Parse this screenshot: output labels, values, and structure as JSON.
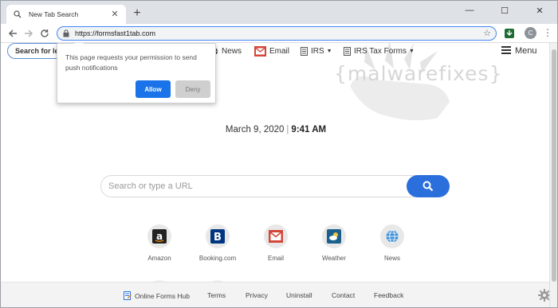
{
  "browser": {
    "tab_title": "New Tab Search",
    "tab_close": "✕",
    "new_tab": "+",
    "window_controls": {
      "minimize": "—",
      "maximize": "☐",
      "close": "✕"
    },
    "url": "https://formsfast1tab.com",
    "profile_initial": "C",
    "accent_color": "#4285f4"
  },
  "page": {
    "site_search_placeholder": "Search for legal forms",
    "topnav": [
      {
        "label": "News",
        "icon": "globe-icon"
      },
      {
        "label": "Email",
        "icon": "gmail-icon"
      },
      {
        "label": "IRS",
        "icon": "document-icon",
        "dropdown": true
      },
      {
        "label": "IRS Tax Forms",
        "icon": "document-icon",
        "dropdown": true
      }
    ],
    "menu_label": "Menu",
    "watermark": "{malwarefixes}",
    "date": "March 9, 2020",
    "time": "9:41 AM",
    "separator": "|",
    "search_placeholder": "Search or type a URL",
    "tiles": [
      {
        "label": "Amazon",
        "icon": "amazon-icon"
      },
      {
        "label": "Booking.com",
        "icon": "booking-icon"
      },
      {
        "label": "Email",
        "icon": "gmail-icon"
      },
      {
        "label": "Weather",
        "icon": "weather-icon"
      },
      {
        "label": "News",
        "icon": "globe-icon"
      }
    ],
    "footer": {
      "links": [
        "Online Forms Hub",
        "Terms",
        "Privacy",
        "Uninstall",
        "Contact",
        "Feedback"
      ]
    }
  },
  "popup": {
    "message": "This page requests your permission to send push notifications",
    "allow_label": "Allow",
    "deny_label": "Deny",
    "allow_color": "#1a73e8"
  }
}
